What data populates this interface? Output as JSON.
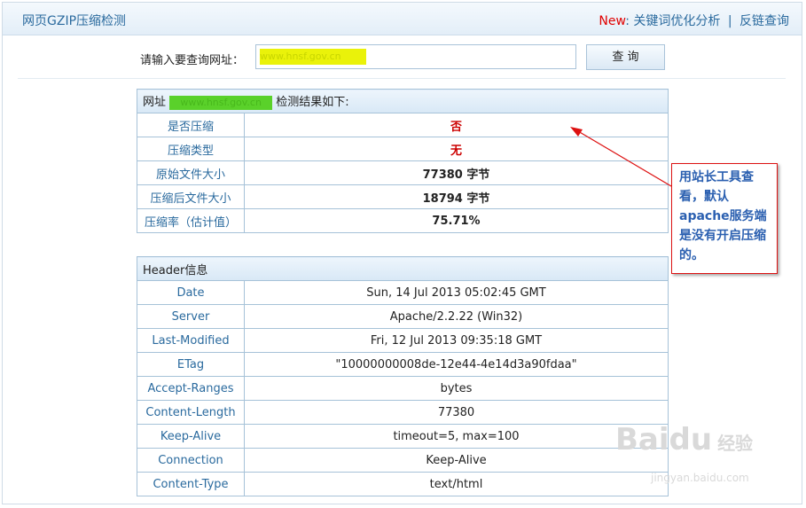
{
  "header": {
    "site_title": "网页GZIP压缩检测",
    "new_label": "New",
    "colon": ":",
    "nav_links": [
      "关键词优化分析",
      "反链查询"
    ],
    "separator": "|"
  },
  "query": {
    "label": "请输入要查询网址：",
    "url_value": "www.hnsf.gov.cn",
    "button_label": "查 询"
  },
  "result": {
    "prefix": "网址",
    "url": "www.hnsf.gov.cn",
    "suffix": "检测结果如下:",
    "rows": [
      {
        "label": "是否压缩",
        "value": "否"
      },
      {
        "label": "压缩类型",
        "value": "无"
      },
      {
        "label": "原始文件大小",
        "value": "77380 字节"
      },
      {
        "label": "压缩后文件大小",
        "value": "18794 字节"
      },
      {
        "label": "压缩率（估计值）",
        "value": "75.71%"
      }
    ]
  },
  "header_info": {
    "title": "Header信息",
    "rows": [
      {
        "label": "Date",
        "value": "Sun, 14 Jul 2013 05:02:45 GMT"
      },
      {
        "label": "Server",
        "value": "Apache/2.2.22 (Win32)"
      },
      {
        "label": "Last-Modified",
        "value": "Fri, 12 Jul 2013 09:35:18 GMT"
      },
      {
        "label": "ETag",
        "value": "\"10000000008de-12e44-4e14d3a90fdaa\""
      },
      {
        "label": "Accept-Ranges",
        "value": "bytes"
      },
      {
        "label": "Content-Length",
        "value": "77380"
      },
      {
        "label": "Keep-Alive",
        "value": "timeout=5, max=100"
      },
      {
        "label": "Connection",
        "value": "Keep-Alive"
      },
      {
        "label": "Content-Type",
        "value": "text/html"
      }
    ]
  },
  "annotation": {
    "text": "用站长工具查看，默认apache服务端是没有开启压缩的。"
  },
  "watermark": {
    "logo": "Baidu",
    "logo_cn": "经验",
    "url": "jingyan.baidu.com"
  },
  "colors": {
    "accent_blue": "#2a6a9e",
    "alert_red": "#cc0000",
    "annotation_border": "#dd1111"
  }
}
